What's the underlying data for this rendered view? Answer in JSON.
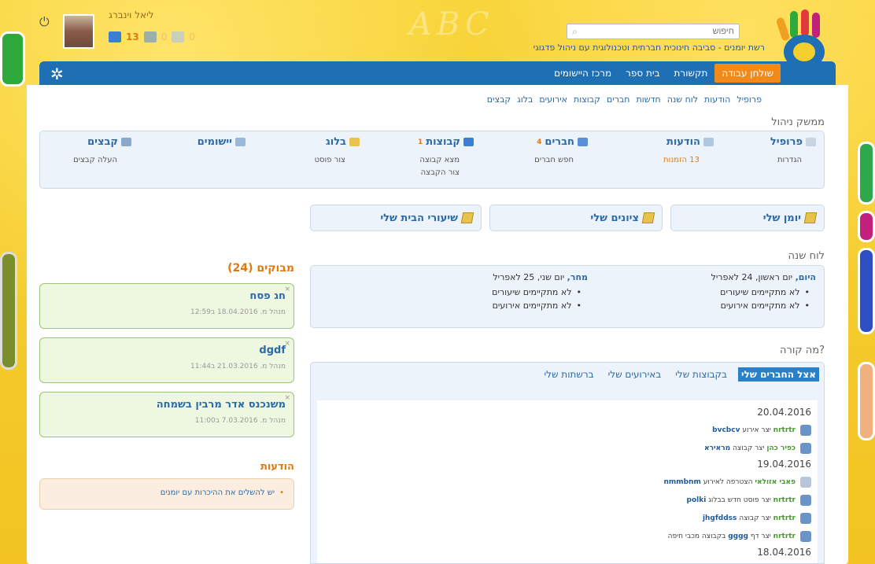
{
  "user": {
    "name": "ליאל וינברג",
    "groups_count": "13",
    "friends_count": "0",
    "messages_count": "0"
  },
  "search": {
    "placeholder": "חיפוש"
  },
  "tagline": "רשת יומנים - סביבה חינוכית חברתית וטכנולוגית עם ניהול פדגוגי",
  "background_text": "ABC",
  "nav": {
    "items": [
      {
        "label": "שולחן עבודה",
        "active": true
      },
      {
        "label": "תקשורת",
        "active": false
      },
      {
        "label": "בית ספר",
        "active": false
      },
      {
        "label": "מרכז היישומים",
        "active": false
      }
    ]
  },
  "subnav": [
    "פרופיל",
    "הודעות",
    "לוח שנה",
    "חדשות",
    "חברים",
    "קבוצות",
    "אירועים",
    "בלוג",
    "קבצים"
  ],
  "management": {
    "title": "ממשק ניהול",
    "columns": [
      {
        "title": "פרופיל",
        "badge": "",
        "links": [
          "הגדרות"
        ]
      },
      {
        "title": "הודעות",
        "badge": "",
        "links": [
          "13 הזמנות"
        ]
      },
      {
        "title": "חברים",
        "badge": "4",
        "links": [
          "חפש חברים"
        ]
      },
      {
        "title": "קבוצות",
        "badge": "1",
        "links": [
          "מצא קבוצה",
          "צור הקבצה"
        ]
      },
      {
        "title": "בלוג",
        "badge": "",
        "links": [
          "צור פוסט"
        ]
      },
      {
        "title": "יישומים",
        "badge": "",
        "links": []
      },
      {
        "title": "קבצים",
        "badge": "",
        "links": [
          "העלה קבצים"
        ]
      }
    ]
  },
  "my_buttons": {
    "diary": "יומן שלי",
    "grades": "ציונים שלי",
    "homework": "שיעורי הבית שלי"
  },
  "calendar": {
    "title": "לוח שנה",
    "today": {
      "label": "היום,",
      "date": " יום ראשון, 24 לאפריל",
      "items": [
        "לא מתקיימים שיעורים",
        "לא מתקיימים אירועים"
      ]
    },
    "tomorrow": {
      "label": "מחר,",
      "date": " יום שני, 25 לאפריל",
      "items": [
        "לא מתקיימים שיעורים",
        "לא מתקיימים אירועים"
      ]
    }
  },
  "happening": {
    "title": "מה קורה?",
    "tabs": [
      {
        "label": "אצל החברים שלי",
        "active": true
      },
      {
        "label": "בקבוצות שלי",
        "active": false
      },
      {
        "label": "באירועים שלי",
        "active": false
      },
      {
        "label": "ברשתות שלי",
        "active": false
      }
    ],
    "days": [
      {
        "date": "20.04.2016",
        "entries": [
          {
            "who": "nrtrtr",
            "action": " יצר אירוע ",
            "obj": "bvcbcv",
            "icon": "group"
          },
          {
            "who": "כפיר כהן",
            "action": " יצר קבוצה ",
            "obj": "מראירא",
            "icon": "group"
          }
        ]
      },
      {
        "date": "19.04.2016",
        "entries": [
          {
            "who": "פאבי אזולאי",
            "action": " הצטרפה לאירוע ",
            "obj": "nmmbnm",
            "icon": "event"
          },
          {
            "who": "nrtrtr",
            "action": " יצר פוסט חדש בבלוג ",
            "obj": "polki",
            "icon": "group"
          },
          {
            "who": "nrtrtr",
            "action": " יצר קבוצה ",
            "obj": "jhgfddss",
            "icon": "group"
          },
          {
            "who": "nrtrtr",
            "action": " יצר דף ",
            "obj": "gggg",
            "tail": " בקבוצה מכבי חיפה",
            "icon": "group"
          }
        ]
      },
      {
        "date": "18.04.2016",
        "entries": []
      }
    ]
  },
  "visited": {
    "title": "מבוקים (24)",
    "cards": [
      {
        "title": "חג פסח",
        "meta": "מנהל מ. 18.04.2016 ב12:59"
      },
      {
        "title": "dgdf",
        "meta": "מנהל מ. 21.03.2016 ב11:44"
      },
      {
        "title": "משנכנס אדר מרבין בשמחה",
        "meta": "מנהל מ. 7.03.2016 ב11:00"
      }
    ]
  },
  "notifications": {
    "title": "הודעות",
    "items": [
      "יש להשלים את ההיכרות עם יומנים"
    ]
  }
}
